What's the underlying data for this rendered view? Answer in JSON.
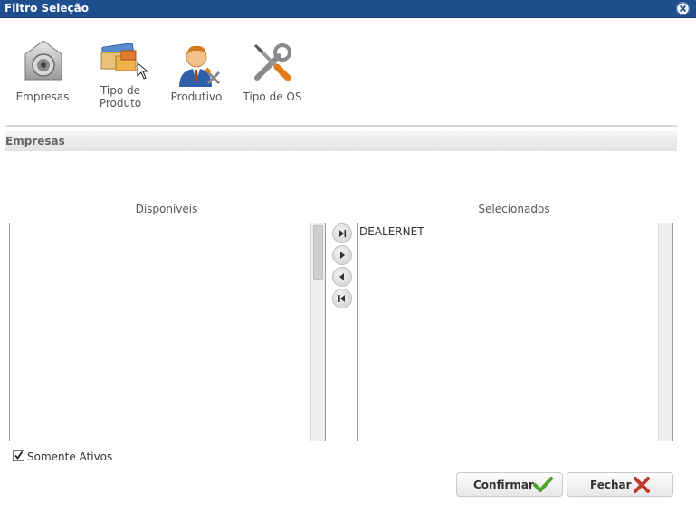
{
  "window": {
    "title": "Filtro Seleção"
  },
  "toolbar": [
    {
      "label": "Empresas",
      "icon": "safe-icon"
    },
    {
      "label": "Tipo de Produto",
      "icon": "product-type-icon"
    },
    {
      "label": "Produtivo",
      "icon": "productive-person-icon"
    },
    {
      "label": "Tipo de OS",
      "icon": "tools-icon"
    }
  ],
  "section": {
    "title": "Empresas"
  },
  "available": {
    "caption": "Disponíveis",
    "items": []
  },
  "selected": {
    "caption": "Selecionados",
    "items": [
      "DEALERNET"
    ]
  },
  "options": {
    "somente_ativos_label": "Somente Ativos",
    "somente_ativos_checked": true
  },
  "buttons": {
    "confirm": "Confirmar",
    "close": "Fechar"
  },
  "colors": {
    "titlebar": "#1f4e8e",
    "confirm_check": "#4aa52a",
    "close_x": "#c0392b"
  }
}
